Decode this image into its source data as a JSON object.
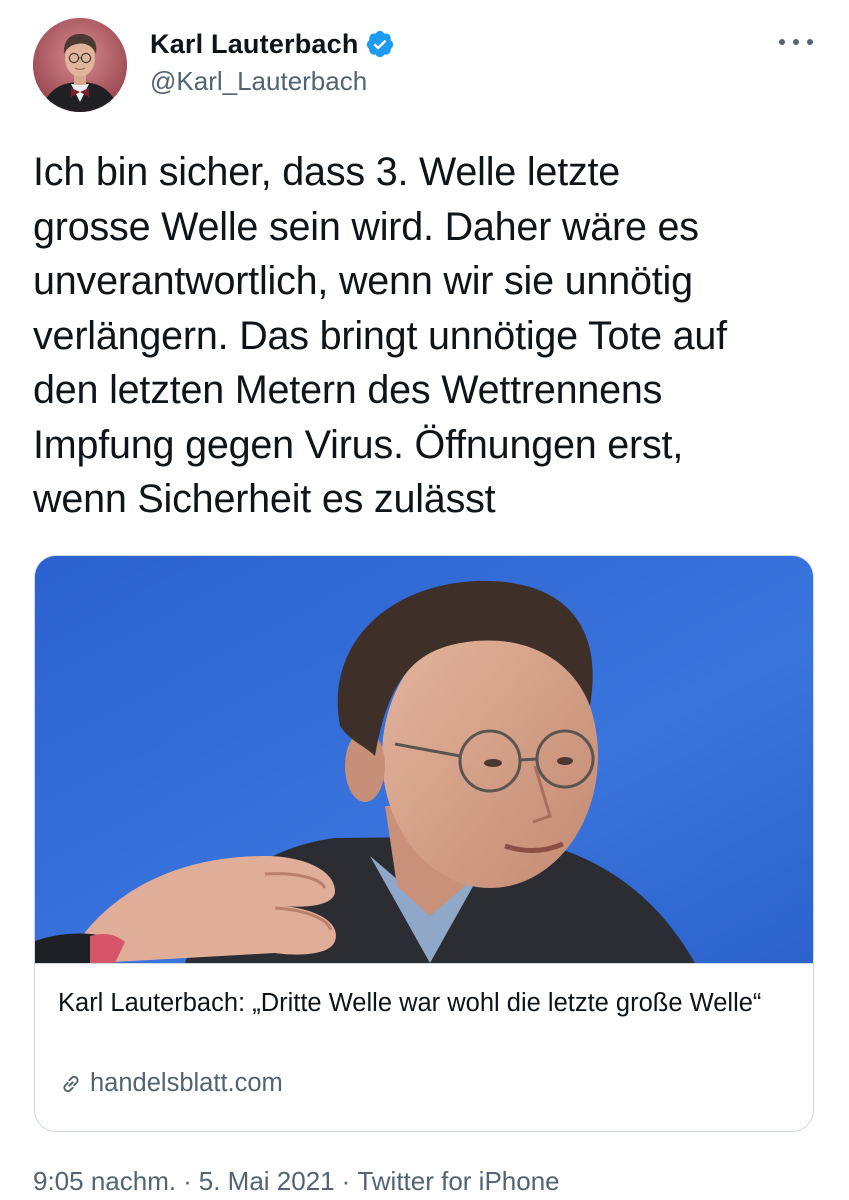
{
  "tweet": {
    "author": {
      "display_name": "Karl Lauterbach",
      "handle": "@Karl_Lauterbach",
      "verified": true
    },
    "text": "Ich bin sicher, dass 3. Welle letzte\ngrosse Welle sein wird. Daher wäre es\nunverantwortlich, wenn wir sie unnötig\nverlängern. Das bringt unnötige Tote auf\nden letzten Metern des Wettrennens\nImpfung gegen Virus. Öffnungen erst,\nwenn Sicherheit es zulässt",
    "card": {
      "title": "Karl Lauterbach: „Dritte Welle war wohl die letzte große Welle“",
      "domain": "handelsblatt.com"
    },
    "meta": {
      "time": "9:05 nachm.",
      "date": "5. Mai 2021",
      "source": "Twitter for iPhone",
      "separator": "·"
    }
  },
  "icons": {
    "more": "more-options-icon",
    "verified": "verified-badge-icon",
    "link": "link-icon"
  },
  "colors": {
    "text": "#0f1419",
    "secondary": "#536471",
    "verified": "#1d9bf0",
    "card_border": "#cfd9de",
    "image_background": "#2f6ad6"
  }
}
